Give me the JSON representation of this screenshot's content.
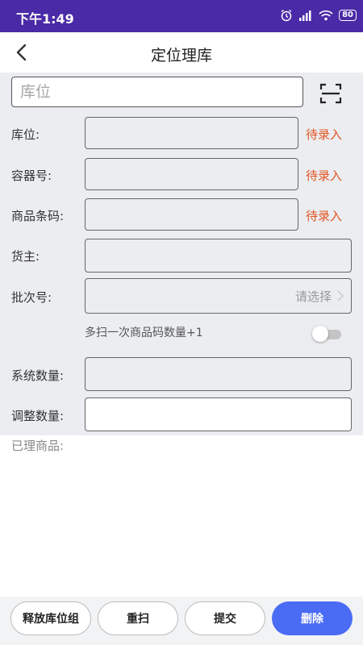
{
  "status_bar": {
    "time": "下午1:49",
    "battery": "80"
  },
  "nav": {
    "title": "定位理库"
  },
  "search": {
    "placeholder": "库位",
    "value": ""
  },
  "fields": {
    "location_label": "库位:",
    "location_status": "待录入",
    "container_label": "容器号:",
    "container_status": "待录入",
    "barcode_label": "商品条码:",
    "barcode_status": "待录入",
    "owner_label": "货主:",
    "batch_label": "批次号:",
    "batch_placeholder": "请选择",
    "multi_scan_hint": "多扫一次商品码数量+1",
    "multi_scan_enabled": false,
    "system_qty_label": "系统数量:",
    "adjust_qty_label": "调整数量:"
  },
  "processed": {
    "label": "已理商品:"
  },
  "buttons": {
    "release": "释放库位组",
    "rescan": "重扫",
    "submit": "提交",
    "delete": "删除"
  },
  "colors": {
    "status_bar": "#4a2aa6",
    "pending": "#e2541f",
    "primary": "#4a6cf5"
  },
  "icons": {
    "back": "back-arrow-icon",
    "scan": "scan-icon",
    "chevron": "chevron-right-icon"
  }
}
